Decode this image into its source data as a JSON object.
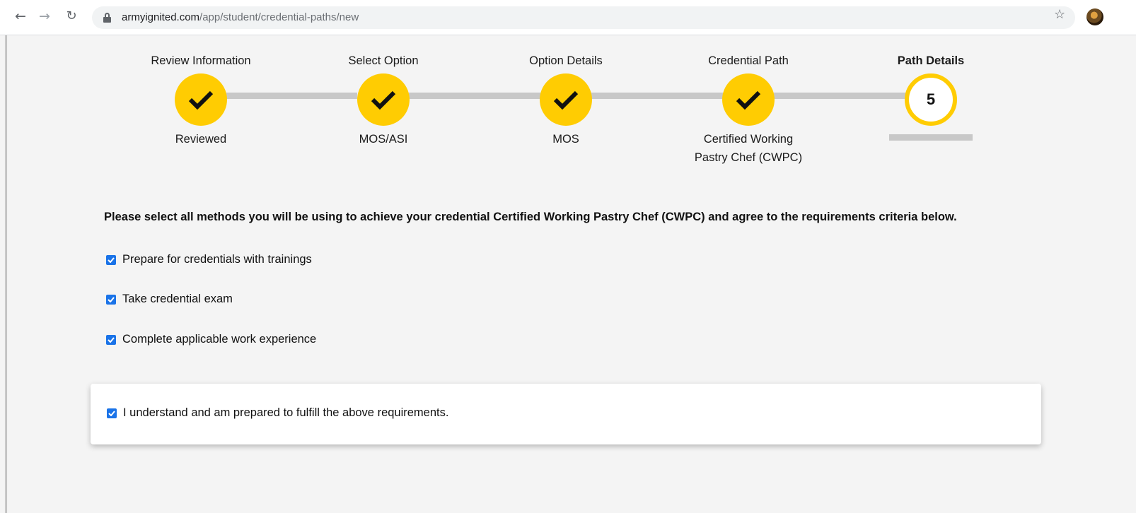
{
  "browser": {
    "url_host": "armyignited.com",
    "url_path": "/app/student/credential-paths/new",
    "back_icon": "arrow-left-icon",
    "forward_icon": "arrow-right-icon",
    "reload_icon": "reload-icon",
    "bookmark_icon": "star-icon"
  },
  "stepper": {
    "steps": [
      {
        "title": "Review Information",
        "status": "done",
        "subtitle_lines": [
          "Reviewed"
        ]
      },
      {
        "title": "Select Option",
        "status": "done",
        "subtitle_lines": [
          "MOS/ASI"
        ]
      },
      {
        "title": "Option Details",
        "status": "done",
        "subtitle_lines": [
          "MOS"
        ]
      },
      {
        "title": "Credential Path",
        "status": "done",
        "subtitle_lines": [
          "Certified Working",
          "Pastry Chef (CWPC)"
        ]
      },
      {
        "title": "Path Details",
        "status": "current",
        "number": "5"
      }
    ],
    "accent_color": "#ffcc02"
  },
  "form": {
    "instructions": "Please select all methods you will be using to achieve your credential Certified Working Pastry Chef (CWPC) and agree to the requirements criteria below.",
    "methods": [
      {
        "label": "Prepare for credentials with trainings",
        "checked": true
      },
      {
        "label": "Take credential exam",
        "checked": true
      },
      {
        "label": "Complete applicable work experience",
        "checked": true
      }
    ],
    "agreement": {
      "label": "I understand and am prepared to fulfill the above requirements.",
      "checked": true
    },
    "checkbox_color": "#1a73e8"
  }
}
